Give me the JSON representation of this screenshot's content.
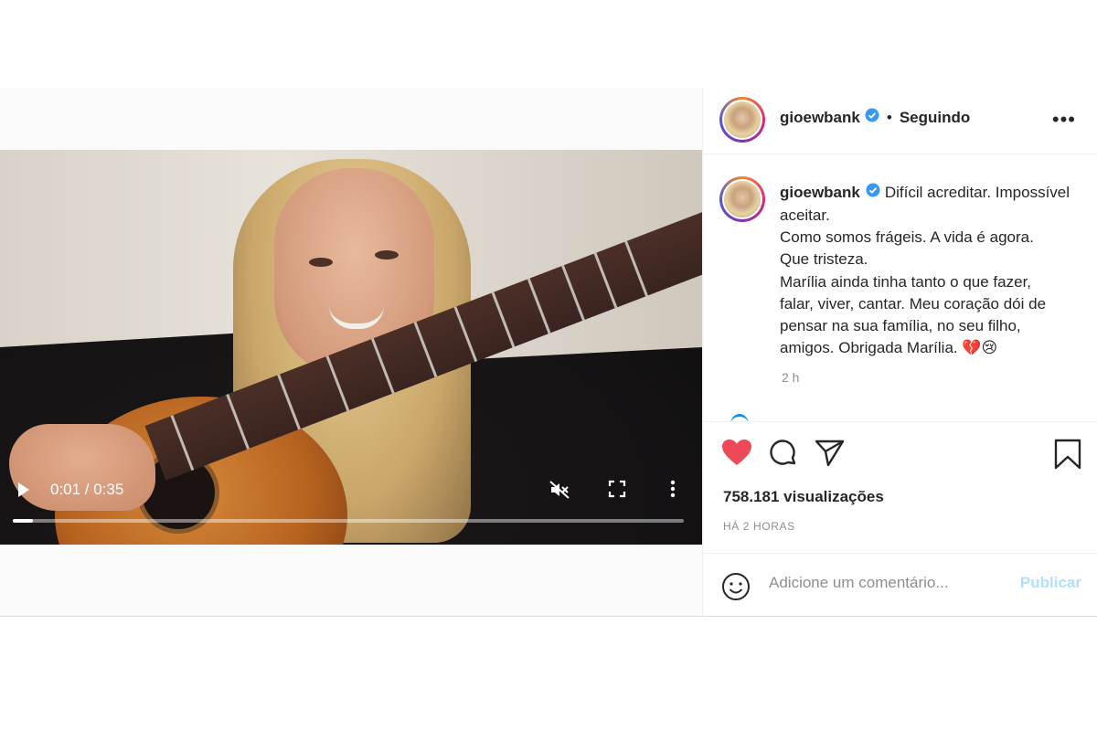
{
  "post": {
    "username": "gioewbank",
    "header": {
      "separator": "•",
      "following_label": "Seguindo",
      "more_label": "•••"
    },
    "caption": {
      "line1": "Difícil acreditar. Impossível",
      "line2": "aceitar.",
      "line3": "Como somos frágeis. A vida é agora.",
      "line4": "Que tristeza.",
      "line5": "Marília ainda tinha tanto o que fazer,",
      "line6": "falar, viver, cantar. Meu coração dói de",
      "line7": "pensar na sua família, no seu filho,",
      "line8": "amigos. Obrigada Marília.",
      "emojis": "💔😢",
      "time": "2 h"
    },
    "video": {
      "time_display": "0:01 / 0:35",
      "progress": 0.03
    },
    "stats": {
      "views": "758.181 visualizações",
      "ago": "HÁ 2 HORAS"
    },
    "comment": {
      "placeholder": "Adicione um comentário...",
      "publish_label": "Publicar"
    },
    "icons": {
      "verified": "verified-badge-icon",
      "like": "heart-filled-icon",
      "comment": "comment-bubble-icon",
      "share": "paper-plane-icon",
      "save": "bookmark-icon",
      "emoji": "smiley-icon"
    },
    "colors": {
      "verified_blue": "#3897f0",
      "like_red": "#ed4956",
      "publish_disabled": "#b2dffc"
    }
  }
}
